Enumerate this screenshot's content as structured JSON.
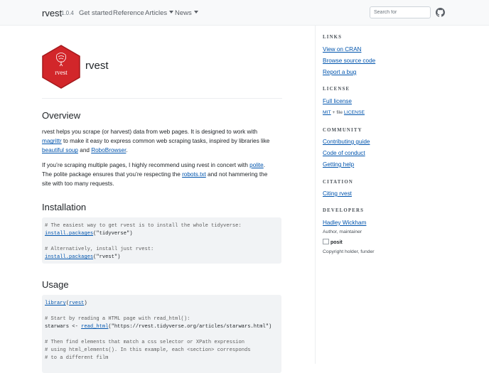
{
  "navbar": {
    "brand": "rvest",
    "version": "1.0.4",
    "links": [
      "Get started",
      "Reference",
      "Articles",
      "News"
    ],
    "search_placeholder": "Search for",
    "github_icon": "github-icon"
  },
  "hero": {
    "logo_text": "rvest",
    "title": "rvest"
  },
  "overview": {
    "heading": "Overview",
    "p1": {
      "t1": "rvest helps you scrape (or harvest) data from web pages. It is designed to work with",
      "l1": "magrittr",
      "t2": " to make it easy to express common web scraping tasks, inspired by libraries like",
      "l2": "beautiful soup",
      "t3": " and ",
      "l3": "RoboBrowser",
      "t4": "."
    },
    "p2": {
      "t1": "If you’re scraping multiple pages, I highly recommend using rvest in concert with ",
      "l1": "polite",
      "t2": ".",
      "t3": "The polite package ensures that you’re respecting the ",
      "l2": "robots.txt",
      "t4": " and not hammering the",
      "t5": "site with too many requests."
    }
  },
  "installation": {
    "heading": "Installation",
    "c1": "# The easiest way to get rvest is to install the whole tidyverse:",
    "fn1": "install.packages",
    "a1": "(\"tidyverse\")",
    "c2": "# Alternatively, install just rvest:",
    "fn2": "install.packages",
    "a2": "(\"rvest\")"
  },
  "usage": {
    "heading": "Usage",
    "fn1": "library",
    "a1_open": "(",
    "pkg": "rvest",
    "a1_close": ")",
    "c1": "# Start by reading a HTML page with read_html():",
    "var": "starwars <- ",
    "fn2": "read_html",
    "a2": "(\"https://rvest.tidyverse.org/articles/starwars.html\")",
    "c2": "# Then find elements that match a css selector or XPath expression",
    "c3": "# using html_elements(). In this example, each <section> corresponds",
    "c4": "# to a different film"
  },
  "sidebar": {
    "links_title": "LINKS",
    "links": [
      "View on CRAN",
      "Browse source code",
      "Report a bug"
    ],
    "license_title": "LICENSE",
    "license_link": "Full license",
    "license_mit": "MIT",
    "license_mid": " + file ",
    "license_file": "LICENSE",
    "community_title": "COMMUNITY",
    "community": [
      "Contributing guide",
      "Code of conduct",
      "Getting help"
    ],
    "citation_title": "CITATION",
    "citation_link": "Citing rvest",
    "developers_title": "DEVELOPERS",
    "dev1_name": "Hadley Wickham",
    "dev1_role": "Author, maintainer",
    "dev2_logo": "posit",
    "dev2_role": "Copyright holder, funder"
  },
  "colors": {
    "link": "#0054AD",
    "logo_red": "#D2262A",
    "code_bg": "#f1f3f5"
  }
}
